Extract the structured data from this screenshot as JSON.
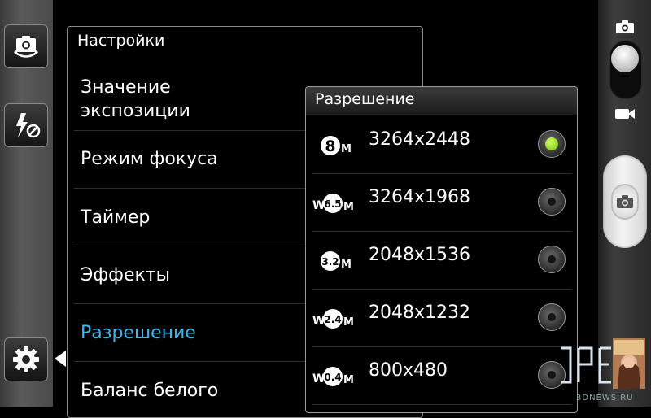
{
  "settings": {
    "title": "Настройки",
    "items": [
      {
        "label": "Значение\nэкспозиции"
      },
      {
        "label": "Режим фокуса"
      },
      {
        "label": "Таймер"
      },
      {
        "label": "Эффекты"
      },
      {
        "label": "Разрешение"
      },
      {
        "label": "Баланс белого"
      }
    ]
  },
  "resolution": {
    "title": "Разрешение",
    "options": [
      {
        "badge": "8",
        "badge_suffix": "M",
        "wide": false,
        "label": "3264x2448",
        "selected": true
      },
      {
        "badge": "6.5",
        "badge_suffix": "M",
        "wide": true,
        "label": "3264x1968",
        "selected": false
      },
      {
        "badge": "3.2",
        "badge_suffix": "M",
        "wide": false,
        "label": "2048x1536",
        "selected": false
      },
      {
        "badge": "2.4",
        "badge_suffix": "M",
        "wide": true,
        "label": "2048x1232",
        "selected": false
      },
      {
        "badge": "0.4",
        "badge_suffix": "M",
        "wide": true,
        "label": "800x480",
        "selected": false
      }
    ]
  },
  "watermark": {
    "text": "3DNEWS.RU"
  },
  "colors": {
    "accent": "#3fb6ea",
    "selected_radio": "#8bd51c"
  },
  "icons": {
    "left_top": "switch-camera-icon",
    "left_mid": "flash-off-icon",
    "left_bottom": "settings-gear-icon",
    "right_top": "camera-mode-icon",
    "right_mid": "video-mode-icon",
    "shutter": "shutter-camera-icon"
  }
}
